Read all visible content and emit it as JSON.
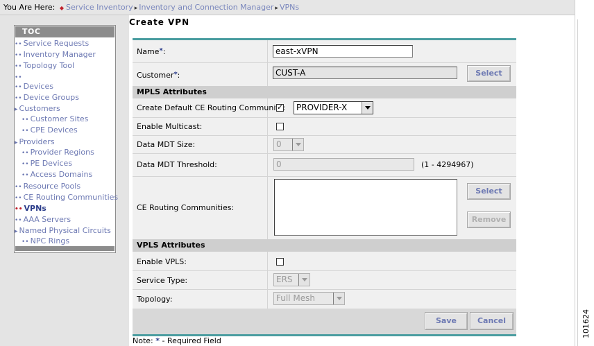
{
  "breadcrumb": {
    "prefix": "You Are Here:",
    "items": [
      "Service Inventory",
      "Inventory and Connection Manager",
      "VPNs"
    ]
  },
  "toc": {
    "title": "TOC",
    "items": [
      {
        "label": "Service Requests",
        "marker": "••"
      },
      {
        "label": "Inventory Manager",
        "marker": "••"
      },
      {
        "label": "Topology Tool",
        "marker": "••"
      },
      {
        "label": "",
        "marker": "••"
      },
      {
        "label": "Devices",
        "marker": "••"
      },
      {
        "label": "Device Groups",
        "marker": "••"
      },
      {
        "label": "Customers",
        "marker": "▸"
      },
      {
        "label": "Customer Sites",
        "marker": "••"
      },
      {
        "label": "CPE Devices",
        "marker": "••"
      },
      {
        "label": "Providers",
        "marker": "▸"
      },
      {
        "label": "Provider Regions",
        "marker": "••"
      },
      {
        "label": "PE Devices",
        "marker": "••"
      },
      {
        "label": "Access Domains",
        "marker": "••"
      },
      {
        "label": "Resource Pools",
        "marker": "••"
      },
      {
        "label": "CE Routing Communities",
        "marker": "••"
      },
      {
        "label": "VPNs",
        "marker": "••",
        "active": true
      },
      {
        "label": "AAA Servers",
        "marker": "••"
      },
      {
        "label": "Named Physical Circuits",
        "marker": "▸"
      },
      {
        "label": "NPC Rings",
        "marker": "••"
      }
    ]
  },
  "page_title": "Create VPN",
  "form": {
    "name_label": "Name",
    "name_value": "east-xVPN",
    "customer_label": "Customer",
    "customer_value": "CUST-A",
    "customer_select_button": "Select",
    "mpls_section": "MPLS Attributes",
    "ce_routing_label": "Create Default CE Routing Community:",
    "ce_routing_checked": true,
    "provider_value": "PROVIDER-X",
    "multicast_label": "Enable Multicast:",
    "multicast_checked": false,
    "mdt_size_label": "Data MDT Size:",
    "mdt_size_value": "0",
    "mdt_threshold_label": "Data MDT Threshold:",
    "mdt_threshold_value": "0",
    "mdt_threshold_range": "(1 - 4294967)",
    "ce_communities_label": "CE Routing Communities:",
    "ce_select_button": "Select",
    "ce_remove_button": "Remove",
    "vpls_section": "VPLS Attributes",
    "enable_vpls_label": "Enable VPLS:",
    "enable_vpls_checked": false,
    "service_type_label": "Service Type:",
    "service_type_value": "ERS",
    "topology_label": "Topology:",
    "topology_value": "Full Mesh",
    "save_button": "Save",
    "cancel_button": "Cancel",
    "required_star": "*"
  },
  "note": {
    "prefix": "Note:",
    "star": "*",
    "suffix": "- Required Field"
  },
  "figure_id": "101624",
  "colors": {
    "link": "#7a87bd",
    "accent_teal": "#4a9da0",
    "active_marker": "#c0202c",
    "active_text": "#2a3c8a"
  }
}
